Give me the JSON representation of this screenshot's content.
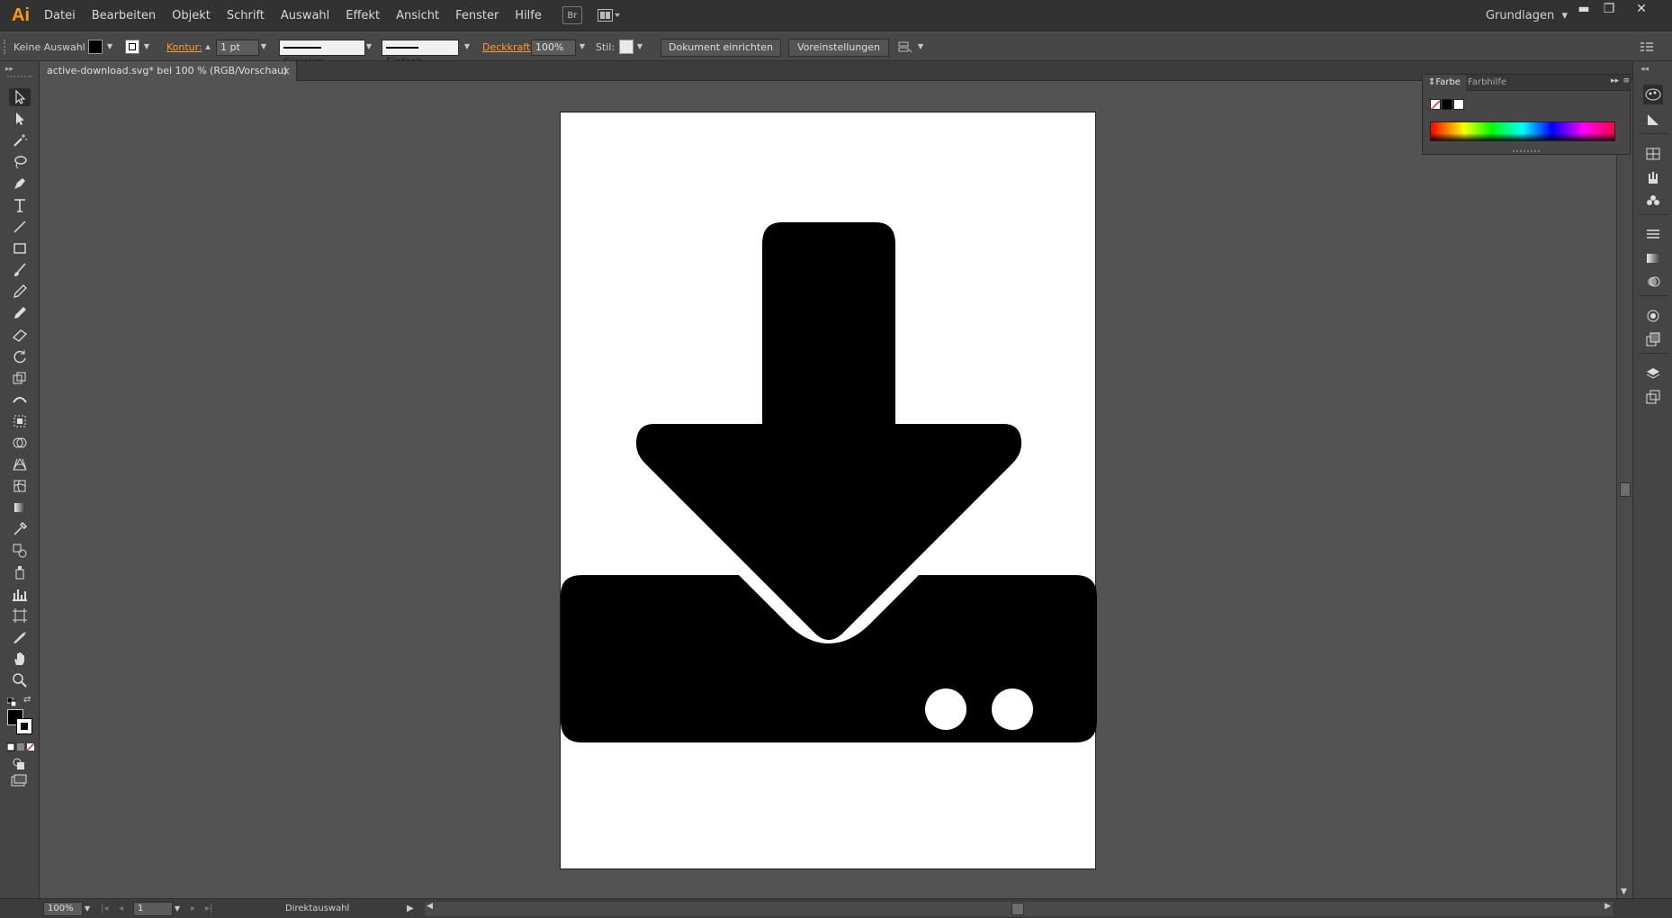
{
  "app": {
    "logo": "Ai",
    "menu": [
      "Datei",
      "Bearbeiten",
      "Objekt",
      "Schrift",
      "Auswahl",
      "Effekt",
      "Ansicht",
      "Fenster",
      "Hilfe"
    ],
    "workspace": "Grundlagen",
    "window_controls": {
      "minimize": "▬",
      "maximize": "❐",
      "close": "✕"
    }
  },
  "controlbar": {
    "selection": "Keine Auswahl",
    "stroke_label": "Kontur:",
    "stroke_weight": "1 pt",
    "profile": "Gleichm.",
    "brush": "Einfach",
    "opacity_label": "Deckkraft:",
    "opacity": "100%",
    "style_label": "Stil:",
    "doc_setup": "Dokument einrichten",
    "preferences": "Voreinstellungen"
  },
  "document": {
    "tab_title": "active-download.svg* bei 100 % (RGB/Vorschau)",
    "close": "×"
  },
  "colorpanel": {
    "tab_active": "Farbe",
    "tab_inactive": "Farbhilfe"
  },
  "statusbar": {
    "zoom": "100%",
    "page": "1",
    "tool_name": "Direktauswahl"
  },
  "colors": {
    "accent": "#ff9a00",
    "canvas": "#535353",
    "artwork": "#000000"
  },
  "tools": [
    "selection-tool",
    "direct-selection-tool",
    "magic-wand-tool",
    "lasso-tool",
    "pen-tool",
    "type-tool",
    "line-segment-tool",
    "rectangle-tool",
    "paintbrush-tool",
    "pencil-tool",
    "blob-brush-tool",
    "eraser-tool",
    "rotate-tool",
    "scale-tool",
    "width-tool",
    "free-transform-tool",
    "shape-builder-tool",
    "perspective-grid-tool",
    "mesh-tool",
    "gradient-tool",
    "eyedropper-tool",
    "blend-tool",
    "symbol-sprayer-tool",
    "column-graph-tool",
    "artboard-tool",
    "slice-tool",
    "hand-tool",
    "zoom-tool"
  ]
}
